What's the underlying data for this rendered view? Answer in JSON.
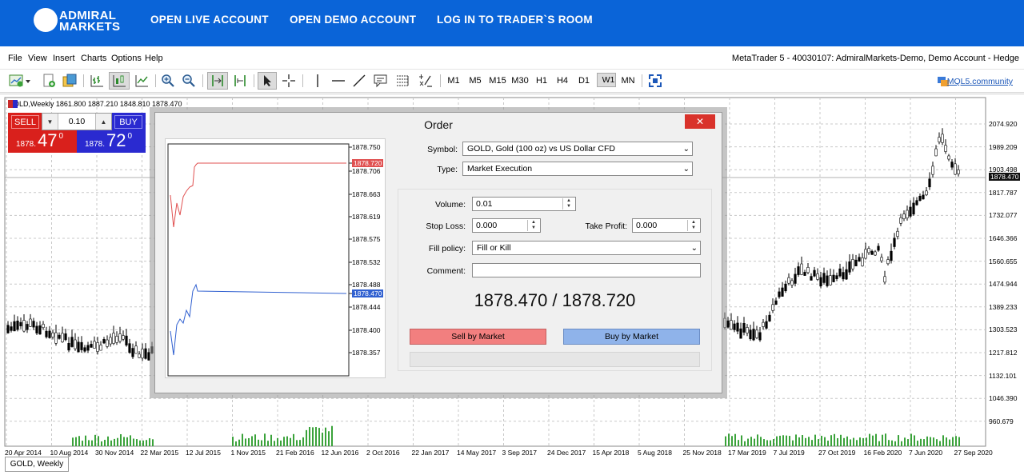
{
  "header": {
    "brand_line1": "ADMIRAL",
    "brand_line2": "MARKETS",
    "nav": [
      "OPEN LIVE ACCOUNT",
      "OPEN DEMO ACCOUNT",
      "LOG IN TO TRADER`S ROOM"
    ]
  },
  "menu": {
    "items": [
      "File",
      "View",
      "Insert",
      "Charts",
      "Options",
      "Help"
    ],
    "window_title": "MetaTrader 5 - 40030107: AdmiralMarkets-Demo, Demo Account - Hedge"
  },
  "toolbar": {
    "timeframes": [
      "M1",
      "M5",
      "M15",
      "M30",
      "H1",
      "H4",
      "D1",
      "W1",
      "MN"
    ],
    "selected_timeframe": "W1",
    "mql5_label": "MQL5.community"
  },
  "chart": {
    "info": "GOLD,Weekly  1861.800 1887.210 1848.810 1878.470",
    "current_price": "1878.470",
    "y_ticks": [
      "2074.920",
      "1989.209",
      "1903.498",
      "1817.787",
      "1732.077",
      "1646.366",
      "1560.655",
      "1474.944",
      "1389.233",
      "1303.523",
      "1217.812",
      "1132.101",
      "1046.390",
      "960.679"
    ],
    "x_ticks": [
      "20 Apr 2014",
      "10 Aug 2014",
      "30 Nov 2014",
      "22 Mar 2015",
      "12 Jul 2015",
      "1 Nov 2015",
      "21 Feb 2016",
      "12 Jun 2016",
      "2 Oct 2016",
      "22 Jan 2017",
      "14 May 2017",
      "3 Sep 2017",
      "24 Dec 2017",
      "15 Apr 2018",
      "5 Aug 2018",
      "25 Nov 2018",
      "17 Mar 2019",
      "7 Jul 2019",
      "27 Oct 2019",
      "16 Feb 2020",
      "7 Jun 2020",
      "27 Sep 2020"
    ],
    "tab_label": "GOLD, Weekly"
  },
  "quick_trade": {
    "sell_label": "SELL",
    "buy_label": "BUY",
    "volume": "0.10",
    "sell_prefix": "1878.",
    "sell_big": "47",
    "sell_sup": "0",
    "buy_prefix": "1878.",
    "buy_big": "72",
    "buy_sup": "0"
  },
  "order_dialog": {
    "title": "Order",
    "close_label": "✕",
    "symbol_label": "Symbol:",
    "symbol_value": "GOLD, Gold (100 oz) vs US Dollar CFD",
    "type_label": "Type:",
    "type_value": "Market Execution",
    "volume_label": "Volume:",
    "volume_value": "0.01",
    "stoploss_label": "Stop Loss:",
    "stoploss_value": "0.000",
    "takeprofit_label": "Take Profit:",
    "takeprofit_value": "0.000",
    "fill_label": "Fill policy:",
    "fill_value": "Fill or Kill",
    "comment_label": "Comment:",
    "comment_value": "",
    "price_display": "1878.470 / 1878.720",
    "sell_button": "Sell by Market",
    "buy_button": "Buy by Market",
    "tick_axis": [
      "1878.750",
      "1878.720",
      "1878.706",
      "1878.663",
      "1878.619",
      "1878.575",
      "1878.532",
      "1878.488",
      "1878.470",
      "1878.444",
      "1878.400",
      "1878.357"
    ],
    "ask_tag": "1878.720",
    "bid_tag": "1878.470"
  },
  "colors": {
    "brand_blue": "#0a64d8",
    "sell_red": "#d9201c",
    "buy_blue": "#2a2ad0",
    "sell_button": "#f27f7f",
    "buy_button": "#8fb3ea"
  }
}
